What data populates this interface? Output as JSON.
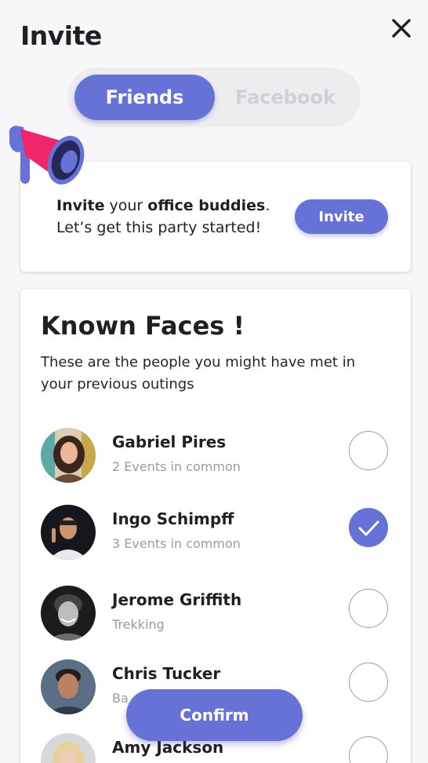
{
  "header": {
    "title": "Invite"
  },
  "tabs": [
    {
      "label": "Friends",
      "active": true
    },
    {
      "label": "Facebook",
      "active": false
    }
  ],
  "invite_card": {
    "bold1": "Invite",
    "text1": " your ",
    "bold2": "office buddies",
    "text2": ".",
    "line2": "Let’s get this party started!",
    "button": "Invite"
  },
  "known_faces": {
    "title": "Known Faces !",
    "subtitle": "These are the people you might have met in your previous outings",
    "people": [
      {
        "name": "Gabriel Pires",
        "detail": "2 Events in common",
        "selected": false,
        "avatar": "avatar-photo"
      },
      {
        "name": "Ingo Schimpff",
        "detail": "3 Events in common",
        "selected": true,
        "avatar": "avatar-photo"
      },
      {
        "name": "Jerome Griffith",
        "detail": "Trekking",
        "selected": false,
        "avatar": "avatar-photo"
      },
      {
        "name": "Chris Tucker",
        "detail": "Ba",
        "selected": false,
        "avatar": "avatar-photo"
      },
      {
        "name": "Amy Jackson",
        "detail": "",
        "selected": false,
        "avatar": "avatar-photo"
      }
    ]
  },
  "confirm_button": "Confirm",
  "colors": {
    "accent": "#6672d6",
    "megaphone_pink": "#f0256a",
    "background": "#f7f7f9"
  },
  "icons": {
    "close": "close-icon",
    "megaphone": "megaphone-icon",
    "check": "checkmark-icon"
  }
}
